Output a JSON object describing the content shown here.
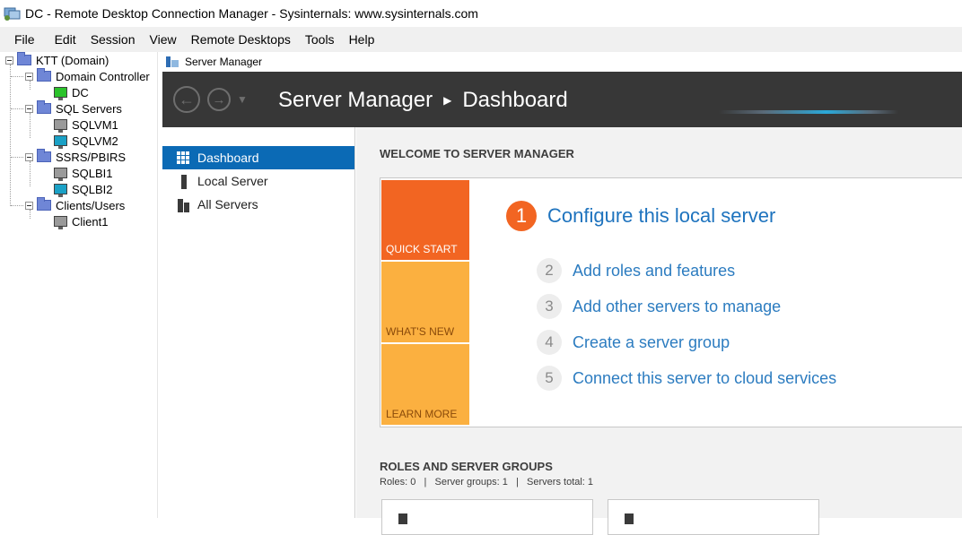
{
  "window": {
    "title": "DC - Remote Desktop Connection Manager - Sysinternals: www.sysinternals.com"
  },
  "menu": [
    "File",
    "Edit",
    "Session",
    "View",
    "Remote Desktops",
    "Tools",
    "Help"
  ],
  "tree": {
    "root": "KTT (Domain)",
    "groups": [
      {
        "label": "Domain Controller",
        "servers": [
          "DC"
        ]
      },
      {
        "label": "SQL Servers",
        "servers": [
          "SQLVM1",
          "SQLVM2"
        ]
      },
      {
        "label": "SSRS/PBIRS",
        "servers": [
          "SQLBI1",
          "SQLBI2"
        ]
      },
      {
        "label": "Clients/Users",
        "servers": [
          "Client1"
        ]
      }
    ]
  },
  "server_manager": {
    "window_label": "Server Manager",
    "breadcrumb": {
      "app": "Server Manager",
      "page": "Dashboard"
    },
    "nav": [
      "Dashboard",
      "Local Server",
      "All Servers"
    ],
    "welcome_heading": "WELCOME TO SERVER MANAGER",
    "tiles": {
      "quick_start": "QUICK START",
      "whats_new": "WHAT'S NEW",
      "learn_more": "LEARN MORE"
    },
    "steps": [
      {
        "num": "1",
        "label": "Configure this local server"
      },
      {
        "num": "2",
        "label": "Add roles and features"
      },
      {
        "num": "3",
        "label": "Add other servers to manage"
      },
      {
        "num": "4",
        "label": "Create a server group"
      },
      {
        "num": "5",
        "label": "Connect this server to cloud services"
      }
    ],
    "roles_heading": "ROLES AND SERVER GROUPS",
    "roles_info": "Roles: 0   |   Server groups: 1   |   Servers total: 1"
  },
  "colors": {
    "accent_orange": "#f26522",
    "tile_yellow": "#fbb040",
    "nav_active": "#0b6ab5",
    "link_blue": "#1e73be",
    "banner": "#373737"
  }
}
